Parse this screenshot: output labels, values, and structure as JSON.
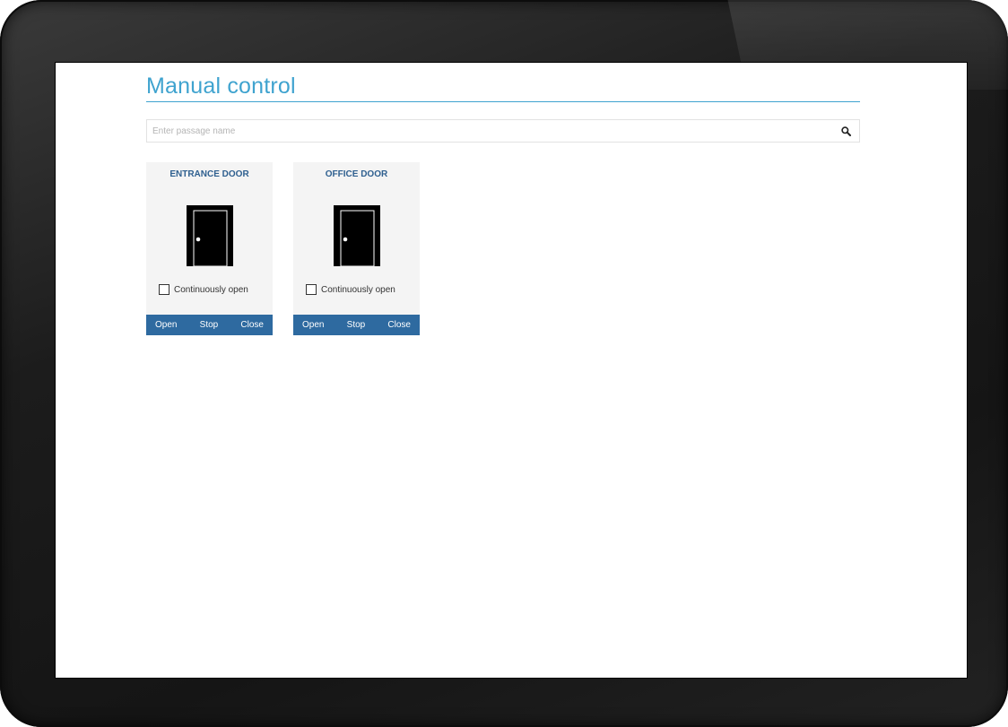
{
  "page": {
    "title": "Manual control"
  },
  "search": {
    "placeholder": "Enter passage name",
    "value": "",
    "icon": "search-icon"
  },
  "colors": {
    "accent": "#3fa3cf",
    "card_title": "#2e5f8f",
    "button_bar": "#2e6aa0",
    "card_bg": "#f4f4f4"
  },
  "doors": [
    {
      "title": "ENTRANCE DOOR",
      "icon": "door-icon",
      "continuously_open_label": "Continuously open",
      "continuously_open_checked": false,
      "buttons": {
        "open": "Open",
        "stop": "Stop",
        "close": "Close"
      }
    },
    {
      "title": "OFFICE DOOR",
      "icon": "door-icon",
      "continuously_open_label": "Continuously open",
      "continuously_open_checked": false,
      "buttons": {
        "open": "Open",
        "stop": "Stop",
        "close": "Close"
      }
    }
  ]
}
